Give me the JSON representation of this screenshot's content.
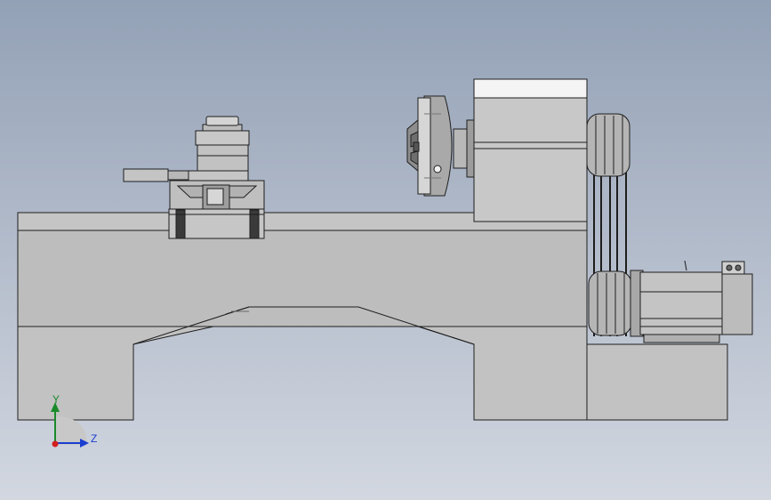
{
  "viewport": {
    "background_top": "#93a1b6",
    "background_bottom": "#d2d7e0"
  },
  "model": {
    "name": "lathe-assembly",
    "part_color": "#c0c0c0",
    "edge_color": "#1e1e1e"
  },
  "triad": {
    "y_label": "Y",
    "z_label": "Z",
    "y_color": "#1a8a2a",
    "z_color": "#1b3fd0",
    "x_color": "#d21e1e"
  }
}
